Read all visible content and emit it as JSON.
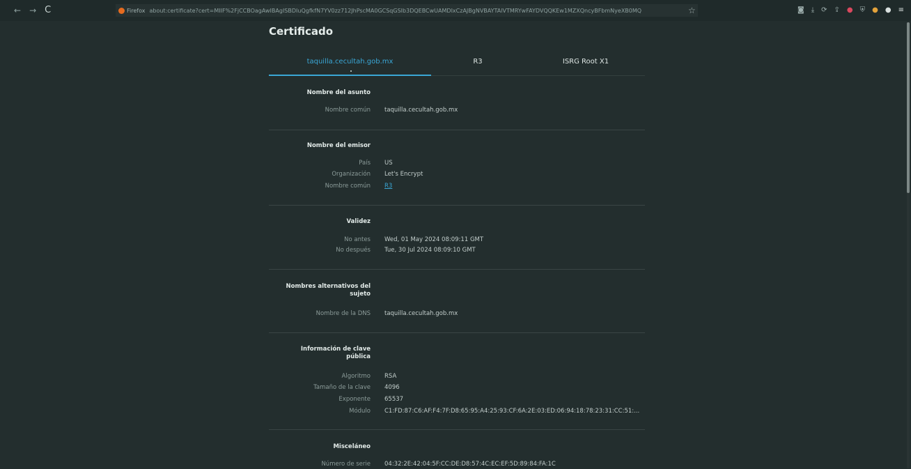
{
  "toolbar": {
    "back": "←",
    "forward": "→",
    "reload": "C",
    "browser_name": "Firefox",
    "url": "about:certificate?cert=MIIF%2FjCCBOagAwIBAgISBDIuQgfkfN7YV0zz712JhPscMA0GCSqGSIb3DQEBCwUAMDIxCzAJBgNVBAYTAlVTMRYwFAYDVQQKEw1MZXQncyBFbmNyeXB0MQ",
    "bookmark_icon": "star-icon"
  },
  "title": "Certificado",
  "tabs": [
    {
      "label": "taquilla.cecultah.gob.mx"
    },
    {
      "label": "R3"
    },
    {
      "label": "ISRG Root X1"
    }
  ],
  "sections": {
    "subject": {
      "title": "Nombre del asunto",
      "rows": [
        {
          "label": "Nombre común",
          "value": "taquilla.cecultah.gob.mx"
        }
      ]
    },
    "issuer": {
      "title": "Nombre del emisor",
      "rows": [
        {
          "label": "País",
          "value": "US"
        },
        {
          "label": "Organización",
          "value": "Let's Encrypt"
        },
        {
          "label": "Nombre común",
          "value": "R3"
        }
      ]
    },
    "validity": {
      "title": "Validez",
      "rows": [
        {
          "label": "No antes",
          "value": "Wed, 01 May 2024 08:09:11 GMT"
        },
        {
          "label": "No después",
          "value": "Tue, 30 Jul 2024 08:09:10 GMT"
        }
      ]
    },
    "san": {
      "title_line1": "Nombres alternativos del",
      "title_line2": "sujeto",
      "rows": [
        {
          "label": "Nombre de la DNS",
          "value": "taquilla.cecultah.gob.mx"
        }
      ]
    },
    "pubkey": {
      "title_line1": "Información de clave",
      "title_line2": "pública",
      "rows": [
        {
          "label": "Algoritmo",
          "value": "RSA"
        },
        {
          "label": "Tamaño de la clave",
          "value": "4096"
        },
        {
          "label": "Exponente",
          "value": "65537"
        },
        {
          "label": "Módulo",
          "value": "C1:FD:87:C6:AF:F4:7F:D8:65:95:A4:25:93:CF:6A:2E:03:ED:06:94:18:78:23:31:CC:51:..."
        }
      ]
    },
    "misc": {
      "title": "Misceláneo",
      "rows": [
        {
          "label": "Número de serie",
          "value": "04:32:2E:42:04:5F:CC:DE:D8:57:4C:EC:EF:5D:89:84:FA:1C"
        }
      ]
    }
  },
  "colors": {
    "background": "#232e2e",
    "accent": "#3aa7d6"
  }
}
